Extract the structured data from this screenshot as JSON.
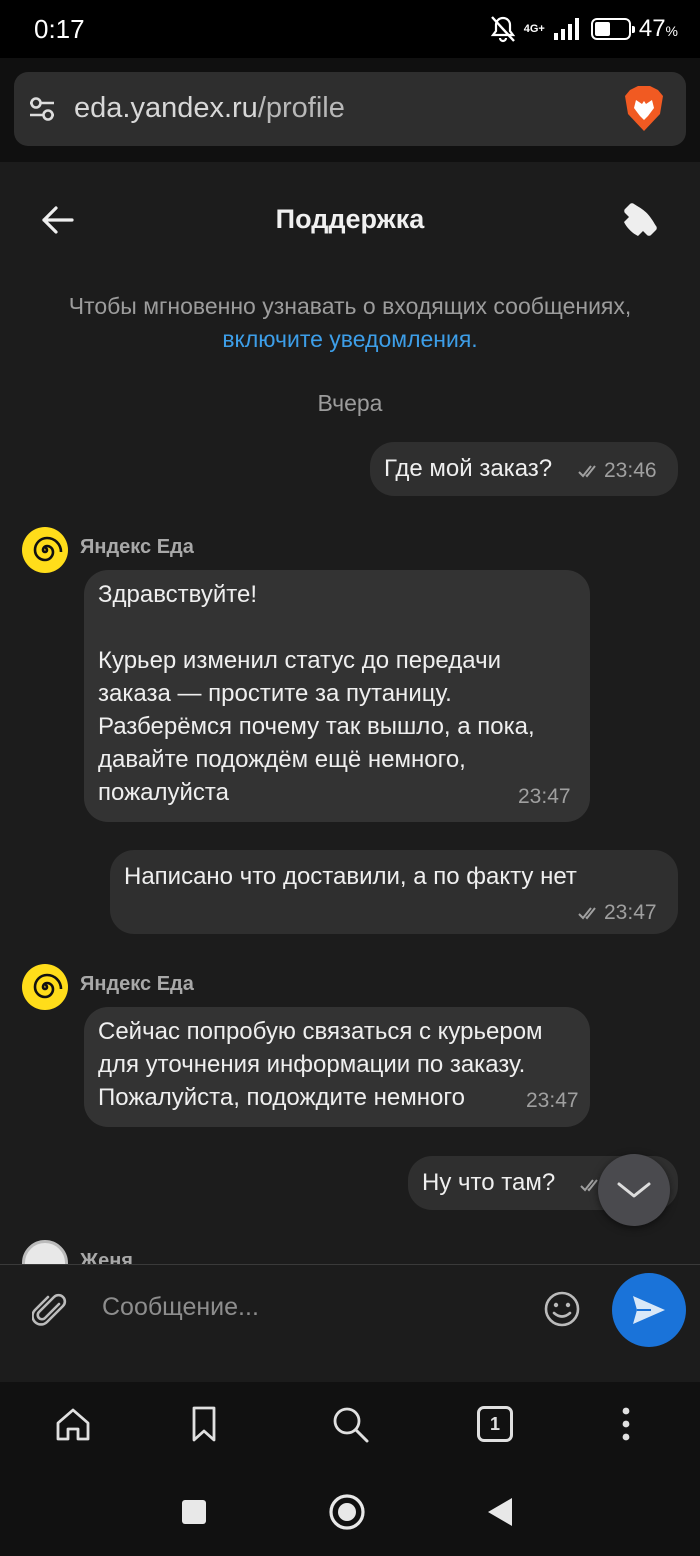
{
  "status_bar": {
    "time": "0:17",
    "network": "4G+",
    "battery_percent": "47",
    "battery_unit": "%",
    "battery_level": 0.47
  },
  "browser": {
    "url_host": "eda.yandex.ru",
    "url_path": "/profile"
  },
  "chat": {
    "title": "Поддержка",
    "notice_text": "Чтобы мгновенно узнавать о входящих сообщениях,",
    "notice_link": "включите уведомления.",
    "date_separator": "Вчера",
    "messages": [
      {
        "direction": "out",
        "text": "Где мой заказ?",
        "time": "23:46"
      },
      {
        "direction": "in",
        "sender": "Яндекс Еда",
        "text": "Здравствуйте!\n\nКурьер изменил статус до передачи заказа — простите за путаницу. Разберёмся почему так вышло, а пока, давайте подождём ещё немного, пожалуйста",
        "time": "23:47"
      },
      {
        "direction": "out",
        "text": "Написано что доставили, а по факту нет",
        "time": "23:47"
      },
      {
        "direction": "in",
        "sender": "Яндекс Еда",
        "text": "Сейчас попробую связаться с курьером для уточнения информации по заказу. Пожалуйста, подождите немного",
        "time": "23:47"
      },
      {
        "direction": "out",
        "text": "Ну что там?",
        "time": ""
      }
    ],
    "partial_sender": "Женя"
  },
  "composer": {
    "placeholder": "Сообщение..."
  },
  "browser_nav": {
    "tab_count": "1"
  },
  "colors": {
    "accent_link": "#3d9ee8",
    "send_button": "#1a73d9",
    "brand_yellow": "#ffdd1a",
    "background": "#1c1c1c"
  }
}
